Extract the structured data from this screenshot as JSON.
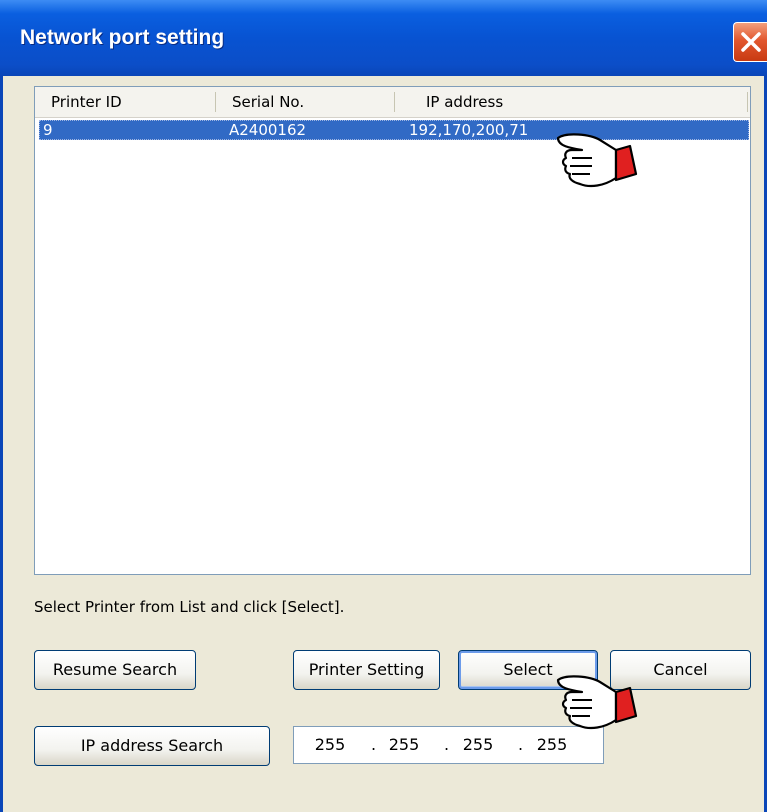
{
  "window": {
    "title": "Network port setting"
  },
  "printer_list": {
    "columns": [
      "Printer ID",
      "Serial No.",
      "IP address"
    ],
    "rows": [
      {
        "printer_id": "9",
        "serial_no": "A2400162",
        "ip_address": "192,170,200,71",
        "selected": true
      }
    ]
  },
  "instruction": "Select Printer from List and click [Select].",
  "buttons": {
    "resume_search": "Resume Search",
    "printer_setting": "Printer Setting",
    "select": "Select",
    "cancel": "Cancel",
    "ip_address_search": "IP address Search"
  },
  "ip_field": {
    "octets": [
      "255",
      "255",
      "255",
      "255"
    ],
    "separator": "."
  },
  "icons": {
    "close": "close-icon",
    "pointer": "pointing-hand-icon"
  },
  "colors": {
    "titlebar": "#0853d2",
    "selection": "#316ac5",
    "dialog_bg": "#ece9d8",
    "close": "#e2572e",
    "hand_cuff": "#e02020"
  }
}
